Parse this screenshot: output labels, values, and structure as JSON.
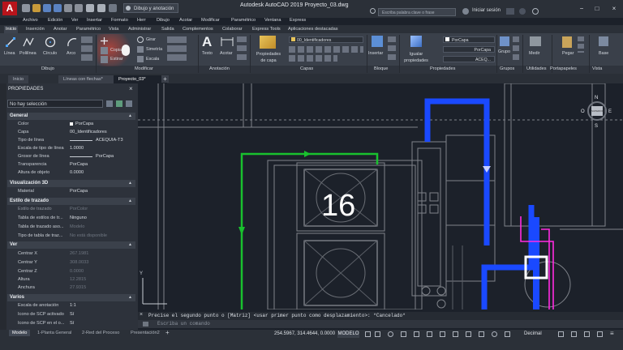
{
  "app": {
    "logo": "A",
    "title": "Autodesk AutoCAD 2019   Proyecto_03.dwg",
    "workspace": "Dibujo y anotación",
    "search_placeholder": "Escriba palabra clave o frase",
    "sign_in": "Iniciar sesión"
  },
  "menu": [
    "Archivo",
    "Edición",
    "Ver",
    "Insertar",
    "Formato",
    "Herr",
    "Dibujo",
    "Acotar",
    "Modificar",
    "Paramétrico",
    "Ventana",
    "Express"
  ],
  "ribbon_tabs": [
    "Inicio",
    "Inserción",
    "Anotar",
    "Paramétrico",
    "Vista",
    "Administrar",
    "Salida",
    "Complementos",
    "Colaborar",
    "Express Tools",
    "Aplicaciones destacadas"
  ],
  "ribbon": {
    "draw_tools": [
      "Línea",
      "Polilínea",
      "Círculo",
      "Arco"
    ],
    "modify_tools": [
      "Girar",
      "Simetría",
      "Escala",
      "Copiar",
      "Estirar"
    ],
    "annotation_tools": [
      "Texto",
      "Acotar"
    ],
    "layer_props": "Propiedades de capa",
    "layer_current": "00_Identificadores",
    "insert": "Insertar",
    "match_props": "Igualar propiedades",
    "color": "PorCapa",
    "linetype": "PorCapa",
    "lineweight": "ACEQ...",
    "group": "Grupo",
    "measure": "Medir",
    "paste": "Pegar",
    "base": "Base",
    "panels": [
      "Dibujo",
      "Modificar",
      "Anotación",
      "Capas",
      "Bloque",
      "Propiedades",
      "Grupos",
      "Utilidades",
      "Portapapeles",
      "Vista"
    ]
  },
  "file_tabs": [
    "Inicio",
    "Líneas con flechas*",
    "Proyecto_03*"
  ],
  "properties": {
    "title": "PROPIEDADES",
    "selection": "No hay selección",
    "sections": {
      "general": "General",
      "vis3d": "Visualización 3D",
      "plot": "Estilo de trazado",
      "view": "Ver",
      "misc": "Varios"
    },
    "general": [
      [
        "Color",
        "PorCapa"
      ],
      [
        "Capa",
        "00_Identificadores"
      ],
      [
        "Tipo de línea",
        "ACEQUIA-T3"
      ],
      [
        "Escala de tipo de línea",
        "1.0000"
      ],
      [
        "Grosor de línea",
        "PorCapa"
      ],
      [
        "Transparencia",
        "PorCapa"
      ],
      [
        "Altura de objeto",
        "0.0000"
      ]
    ],
    "vis3d": [
      [
        "Material",
        "PorCapa"
      ]
    ],
    "plot": [
      [
        "Estilo de trazado",
        "PorColor"
      ],
      [
        "Tabla de estilos de tr...",
        "Ninguno"
      ],
      [
        "Tabla de trazado aso...",
        "Modelo"
      ],
      [
        "Tipo de tabla de traz...",
        "No está disponible"
      ]
    ],
    "view": [
      [
        "Centrar X",
        "267.1981"
      ],
      [
        "Centrar Y",
        "308.0033"
      ],
      [
        "Centrar Z",
        "0.0000"
      ],
      [
        "Altura",
        "12.2815"
      ],
      [
        "Anchura",
        "27.9315"
      ]
    ],
    "misc": [
      [
        "Escala de anotación",
        "1:1"
      ],
      [
        "Icono de SCP activado",
        "Sí"
      ],
      [
        "Icono de SCP en el o...",
        "Sí"
      ]
    ]
  },
  "drawing": {
    "label": "16",
    "viewcube": {
      "n": "N",
      "s": "S",
      "e": "E",
      "o": "O",
      "face": "SUPERIOR"
    },
    "colors": {
      "blue": "#1a49ff",
      "green": "#19c12e",
      "magenta": "#ff2be0",
      "white": "#ffffff",
      "grey": "#8a8e96"
    }
  },
  "command": {
    "history": "Precise el segundo punto o [Matriz] <usar primer punto como desplazamiento>: *Cancelado*",
    "placeholder": "Escriba un comando"
  },
  "status": {
    "layouts": [
      "Modelo",
      "1-Planta General",
      "2-Red del Proceso",
      "Presentación2"
    ],
    "coords": "254.5967, 314.4644, 0.0000",
    "model": "MODELO",
    "units": "Decimal"
  }
}
